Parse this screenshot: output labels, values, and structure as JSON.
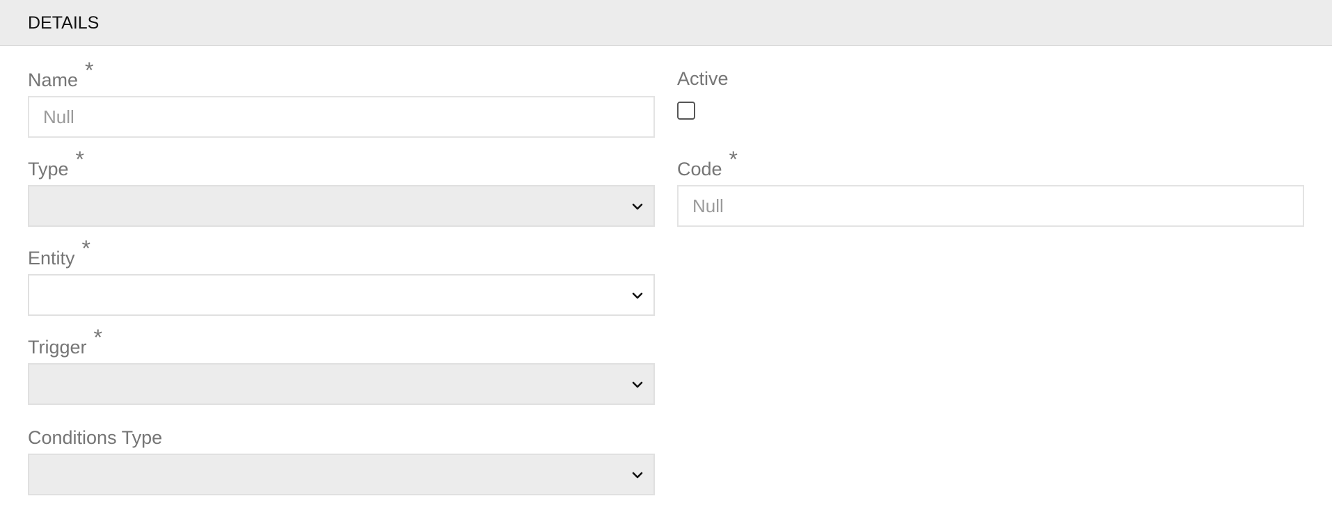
{
  "panel": {
    "title": "DETAILS"
  },
  "fields": {
    "name": {
      "label": "Name",
      "required_mark": "*",
      "placeholder": "Null",
      "value": ""
    },
    "active": {
      "label": "Active",
      "checked": false
    },
    "type": {
      "label": "Type",
      "required_mark": "*",
      "value": "",
      "disabled": true,
      "icon": "chevron-down-icon"
    },
    "code": {
      "label": "Code",
      "required_mark": "*",
      "placeholder": "Null",
      "value": ""
    },
    "entity": {
      "label": "Entity",
      "required_mark": "*",
      "value": "",
      "disabled": false,
      "icon": "chevron-down-icon"
    },
    "trigger": {
      "label": "Trigger",
      "required_mark": "*",
      "value": "",
      "disabled": true,
      "icon": "chevron-down-icon"
    },
    "conditions_type": {
      "label": "Conditions Type",
      "value": "",
      "disabled": true,
      "icon": "chevron-down-icon"
    }
  },
  "colors": {
    "header_bg": "#ececec",
    "label": "#757575",
    "disabled_bg": "#ececec",
    "border": "#e0e0e0"
  }
}
